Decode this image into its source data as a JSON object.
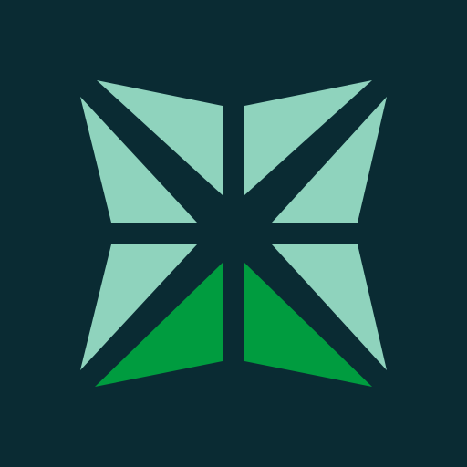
{
  "logo": {
    "icon": "faceted-star-logo-icon",
    "colors": {
      "background": "#0a2b33",
      "light_facet": "#8fd3bd",
      "dark_facet": "#009c3f"
    }
  }
}
